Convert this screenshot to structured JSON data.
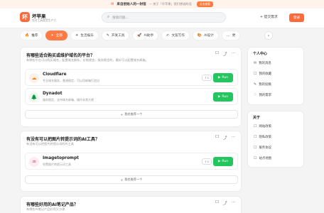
{
  "announcement": {
    "icon": "red-envelope-icon",
    "headline": "来自创始人的一封信",
    "text": "— 关于「坏苹果」我们想说的话",
    "button": "点击查看"
  },
  "header": {
    "logo_char": "坏",
    "brand_name": "坏苹果",
    "brand_sub": "找对工具就是生产力",
    "search_placeholder": "搜索问题...",
    "submit_label": "提交需求",
    "login_label": "登录"
  },
  "tabs": [
    {
      "icon": "🔥",
      "label": "推荐",
      "active": false
    },
    {
      "icon": "✦",
      "label": "全部",
      "active": true
    },
    {
      "icon": "☀",
      "label": "生活娱乐",
      "active": false
    },
    {
      "icon": "✎",
      "label": "开发工具",
      "active": false
    },
    {
      "icon": "🚀",
      "label": "AI助手",
      "active": false
    },
    {
      "icon": "✍",
      "label": "文案写作",
      "active": false
    },
    {
      "icon": "🎨",
      "label": "AI设计",
      "active": false
    },
    {
      "icon": "…",
      "label": "更",
      "active": false
    }
  ],
  "questions": [
    {
      "title": "有哪些适合购买或维护域名的平台？",
      "subtitle": "有哪些平台可以购买域名，配置域名解析，价格便宜，服务稳定的，最好可以配置域名邮箱。",
      "tools": [
        {
          "name": "Cloudflare",
          "desc": "专业域名服务，靠谱稳定，可以用邮箱打造自",
          "icon": "☁",
          "icon_bg": "#fdf1e7",
          "count": "1",
          "run": "Run"
        },
        {
          "name": "Dynadot",
          "desc": "服务稳定，支持域名邮箱，操作非常方便",
          "icon": "🌲",
          "icon_bg": "#ecf7ee",
          "count": "1",
          "run": "Run"
        }
      ],
      "recommend": "我也推荐一个"
    },
    {
      "title": "有没有可以把图片转提示词的AI工具？",
      "subtitle": "有没有可以把图片转提示词的AI工具",
      "tools": [
        {
          "name": "Imagetoprompt",
          "desc": "免费图片转提示词工具",
          "icon": "♒",
          "icon_bg": "#fdecef",
          "count": "1",
          "run": "Run"
        }
      ],
      "recommend": "我也推荐一个"
    },
    {
      "title": "有哪些好用的AI笔记产品？",
      "subtitle": "有哪些AI笔记产品好用又方便",
      "tools": [],
      "recommend": ""
    }
  ],
  "sidebar": {
    "personal": {
      "title": "个人中心",
      "items": [
        {
          "icon": "✉",
          "label": "我的消息"
        },
        {
          "icon": "☐",
          "label": "我的收藏"
        },
        {
          "icon": "✎",
          "label": "我的投稿"
        },
        {
          "icon": "♡",
          "label": "我的需求"
        }
      ]
    },
    "about": {
      "title": "关于",
      "items": [
        {
          "icon": "☐",
          "label": "网站政策"
        },
        {
          "icon": "☐",
          "label": "隐私政策"
        },
        {
          "icon": "☐",
          "label": "服务协议"
        },
        {
          "icon": "☐",
          "label": "站点地图"
        }
      ]
    }
  },
  "colors": {
    "accent": "#ff6a3c",
    "run": "#22c55e"
  }
}
